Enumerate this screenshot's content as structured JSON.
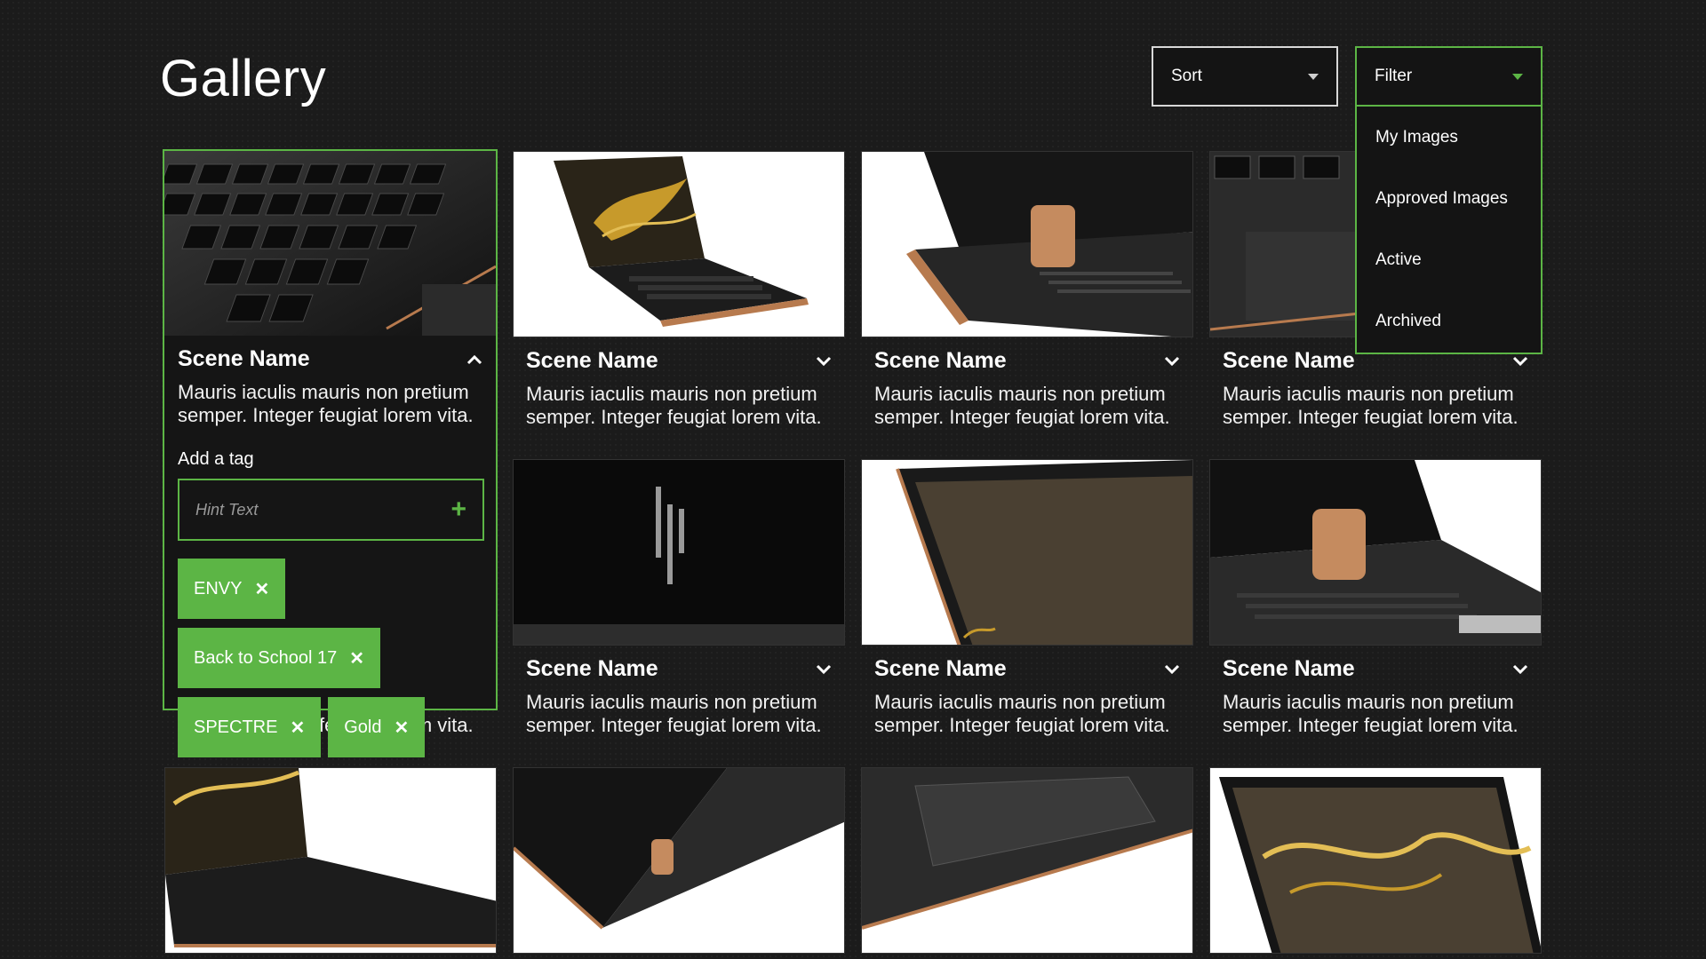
{
  "page": {
    "title": "Gallery"
  },
  "controls": {
    "sort_label": "Sort",
    "filter_label": "Filter",
    "filter_options": [
      "My Images",
      "Approved Images",
      "Active",
      "Archived"
    ]
  },
  "card": {
    "scene_name": "Scene Name",
    "description": "Mauris iaculis mauris non pretium semper. Integer feugiat lorem vita.",
    "description_tail": "semper. Integer feugiat lorem vita."
  },
  "expanded": {
    "add_tag_label": "Add a tag",
    "tag_placeholder": "Hint Text",
    "tags": [
      "ENVY",
      "Back to School 17",
      "SPECTRE",
      "Gold"
    ]
  },
  "colors": {
    "accent": "#5cb545",
    "background": "#1b1b1b"
  }
}
